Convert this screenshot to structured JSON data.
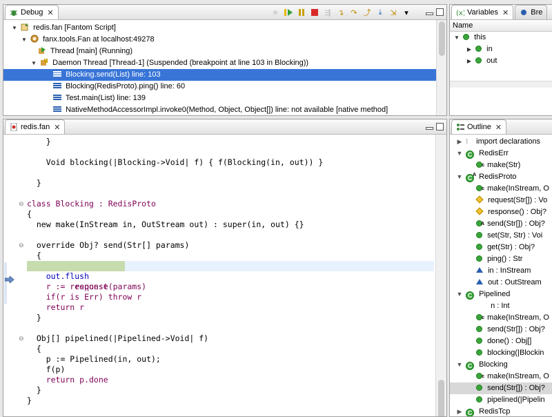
{
  "debug": {
    "tab_label": "Debug",
    "tree": [
      {
        "label": "redis.fan [Fantom Script]"
      },
      {
        "label": "fanx.tools.Fan at localhost:49278"
      },
      {
        "label": "Thread [main] (Running)"
      },
      {
        "label": "Daemon Thread [Thread-1] (Suspended (breakpoint at line 103 in Blocking))"
      },
      {
        "label": "Blocking.send(List) line: 103"
      },
      {
        "label": "Blocking(RedisProto).ping() line: 60"
      },
      {
        "label": "Test.main(List) line: 139"
      },
      {
        "label": "NativeMethodAccessorImpl.invoke0(Method, Object, Object[]) line: not available [native method]"
      }
    ]
  },
  "variables": {
    "tab_label": "Variables",
    "second_tab_label": "Bre",
    "column_name": "Name",
    "items": [
      {
        "label": "this"
      },
      {
        "label": "in"
      },
      {
        "label": "out"
      }
    ]
  },
  "editor": {
    "tab_label": "redis.fan",
    "lines": [
      "    }",
      "",
      "    Void blocking(|Blocking->Void| f) { f(Blocking(in, out)) }",
      "",
      "  }",
      "",
      "class Blocking : RedisProto",
      "{",
      "  new make(InStream in, OutStream out) : super(in, out) {}",
      "",
      "  override Obj? send(Str[] params)",
      "  {",
      "    request(params)",
      "    out.flush",
      "    r := response",
      "    if(r is Err) throw r",
      "    return r",
      "  }",
      "",
      "  Obj[] pipelined(|Pipelined->Void| f)",
      "  {",
      "    p := Pipelined(in, out);",
      "    f(p)",
      "    return p.done",
      "  }",
      "}"
    ]
  },
  "outline": {
    "tab_label": "Outline",
    "items": [
      {
        "label": "import declarations"
      },
      {
        "label": "RedisErr"
      },
      {
        "label": "make(Str)"
      },
      {
        "label": "RedisProto"
      },
      {
        "label": "make(InStream, O"
      },
      {
        "label": "request(Str[]) : Vo"
      },
      {
        "label": "response() : Obj?"
      },
      {
        "label": "send(Str[]) : Obj?"
      },
      {
        "label": "set(Str, Str) : Voi"
      },
      {
        "label": "get(Str) : Obj?"
      },
      {
        "label": "ping() : Str"
      },
      {
        "label": "in : InStream"
      },
      {
        "label": "out : OutStream"
      },
      {
        "label": "Pipelined"
      },
      {
        "label": "n : Int"
      },
      {
        "label": "make(InStream, O"
      },
      {
        "label": "send(Str[]) : Obj?"
      },
      {
        "label": "done() : Obj[]"
      },
      {
        "label": "blocking(|Blockin"
      },
      {
        "label": "Blocking"
      },
      {
        "label": "make(InStream, O"
      },
      {
        "label": "send(Str[]) : Obj?"
      },
      {
        "label": "pipelined(|Pipelin"
      },
      {
        "label": "RedisTcp"
      }
    ]
  },
  "colors": {
    "selection": "#3875d7",
    "current_line": "#e8f2fe",
    "highlight": "#c6dbae",
    "keyword": "#7f0055",
    "field": "#0000c0"
  }
}
